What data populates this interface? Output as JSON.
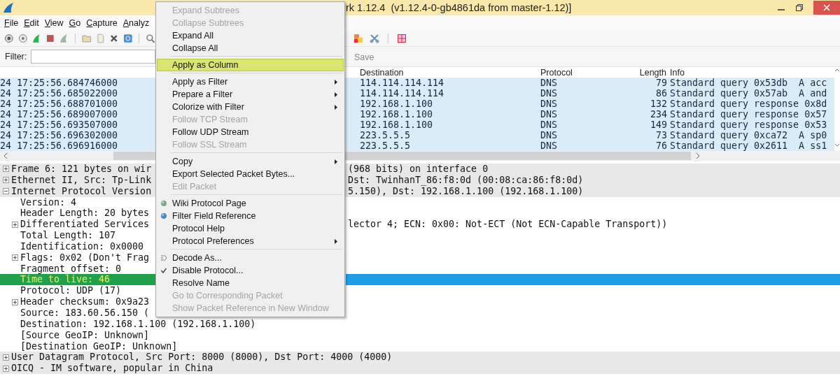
{
  "window": {
    "title": "rk 1.12.4  (v1.12.4-0-gb4861da from master-1.12)]"
  },
  "menu_bar": [
    "File",
    "Edit",
    "View",
    "Go",
    "Capture",
    "Analyz"
  ],
  "filter_bar": {
    "label": "Filter:",
    "save": "Save"
  },
  "packet_list": {
    "columns": [
      "Destination",
      "Protocol",
      "Length",
      "Info"
    ],
    "rows": [
      {
        "time": "24 17:25:56.684746000",
        "destination": "114.114.114.114",
        "protocol": "DNS",
        "length": "79",
        "info": "Standard query 0x53db  A acc"
      },
      {
        "time": "24 17:25:56.685022000",
        "destination": "114.114.114.114",
        "protocol": "DNS",
        "length": "86",
        "info": "Standard query 0x57ab  A and"
      },
      {
        "time": "24 17:25:56.688701000",
        "destination": "192.168.1.100",
        "protocol": "DNS",
        "length": "132",
        "info": "Standard query response 0x8d"
      },
      {
        "time": "24 17:25:56.689007000",
        "destination": "192.168.1.100",
        "protocol": "DNS",
        "length": "234",
        "info": "Standard query response 0x57"
      },
      {
        "time": "24 17:25:56.693507000",
        "destination": "192.168.1.100",
        "protocol": "DNS",
        "length": "149",
        "info": "Standard query response 0x53"
      },
      {
        "time": "24 17:25:56.696302000",
        "destination": "223.5.5.5",
        "protocol": "DNS",
        "length": "73",
        "info": "Standard query 0xca72  A sp0"
      },
      {
        "time": "24 17:25:56.696916000",
        "destination": "223.5.5.5",
        "protocol": "DNS",
        "length": "76",
        "info": "Standard query 0x2611  A ss1"
      }
    ]
  },
  "details": [
    {
      "text": "Frame 6: 121 bytes on wir",
      "text_right": "(968 bits) on interface 0",
      "expanded": false,
      "selected": false
    },
    {
      "text": "Ethernet II, Src: Tp-Link",
      "text_right": "Dst: TwinhanT_86:f8:0d (00:08:ca:86:f8:0d)",
      "expanded": false,
      "selected": false
    },
    {
      "text": "Internet Protocol Version",
      "text_right": "5.150), Dst: 192.168.1.100 (192.168.1.100)",
      "expanded": true,
      "selected": false,
      "children": [
        {
          "text": "Version: 4",
          "selected": false
        },
        {
          "text": "Header Length: 20 bytes",
          "selected": false
        },
        {
          "text": "Differentiated Services",
          "text_right": "lector 4; ECN: 0x00: Not-ECT (Not ECN-Capable Transport))",
          "expanded": false,
          "selected": false
        },
        {
          "text": "Total Length: 107",
          "selected": false
        },
        {
          "text": "Identification: 0x0000",
          "selected": false
        },
        {
          "text": "Flags: 0x02 (Don't Frag",
          "expanded": false,
          "selected": false
        },
        {
          "text": "Fragment offset: 0",
          "selected": false
        },
        {
          "text": "Time to live: 46",
          "selected": true
        },
        {
          "text": "Protocol: UDP (17)",
          "selected": false
        },
        {
          "text": "Header checksum: 0x9a23",
          "expanded": false,
          "selected": false
        },
        {
          "text": "Source: 183.60.56.150 (",
          "selected": false
        },
        {
          "text": "Destination: 192.168.1.100 (192.168.1.100)",
          "selected": false
        },
        {
          "text": "[Source GeoIP: Unknown]",
          "selected": false
        },
        {
          "text": "[Destination GeoIP: Unknown]",
          "selected": false
        }
      ]
    },
    {
      "text": "User Datagram Protocol, Src Port: 8000 (8000), Dst Port: 4000 (4000)",
      "expanded": false,
      "selected": false
    },
    {
      "text": "OICQ - IM software, popular in China",
      "expanded": false,
      "selected": false
    }
  ],
  "context_menu": [
    {
      "kind": "item",
      "label": "Expand Subtrees",
      "disabled": true,
      "selected": false,
      "submenu": false
    },
    {
      "kind": "item",
      "label": "Collapse Subtrees",
      "disabled": true,
      "selected": false,
      "submenu": false
    },
    {
      "kind": "item",
      "label": "Expand All",
      "disabled": false,
      "selected": false,
      "submenu": false
    },
    {
      "kind": "item",
      "label": "Collapse All",
      "disabled": false,
      "selected": false,
      "submenu": false
    },
    {
      "kind": "separator"
    },
    {
      "kind": "item",
      "label": "Apply as Column",
      "disabled": false,
      "selected": true,
      "submenu": false
    },
    {
      "kind": "separator"
    },
    {
      "kind": "item",
      "label": "Apply as Filter",
      "disabled": false,
      "selected": false,
      "submenu": true
    },
    {
      "kind": "item",
      "label": "Prepare a Filter",
      "disabled": false,
      "selected": false,
      "submenu": true
    },
    {
      "kind": "item",
      "label": "Colorize with Filter",
      "disabled": false,
      "selected": false,
      "submenu": true
    },
    {
      "kind": "item",
      "label": "Follow TCP Stream",
      "disabled": true,
      "selected": false,
      "submenu": false
    },
    {
      "kind": "item",
      "label": "Follow UDP Stream",
      "disabled": false,
      "selected": false,
      "submenu": false
    },
    {
      "kind": "item",
      "label": "Follow SSL Stream",
      "disabled": true,
      "selected": false,
      "submenu": false
    },
    {
      "kind": "separator"
    },
    {
      "kind": "item",
      "label": "Copy",
      "disabled": false,
      "selected": false,
      "submenu": true
    },
    {
      "kind": "item",
      "label": "Export Selected Packet Bytes...",
      "disabled": false,
      "selected": false,
      "submenu": false
    },
    {
      "kind": "item",
      "label": "Edit Packet",
      "disabled": true,
      "selected": false,
      "submenu": false
    },
    {
      "kind": "separator"
    },
    {
      "kind": "item",
      "label": "Wiki Protocol Page",
      "disabled": false,
      "selected": false,
      "submenu": false
    },
    {
      "kind": "item",
      "label": "Filter Field Reference",
      "disabled": false,
      "selected": false,
      "submenu": false
    },
    {
      "kind": "item",
      "label": "Protocol Help",
      "disabled": false,
      "selected": false,
      "submenu": false
    },
    {
      "kind": "item",
      "label": "Protocol Preferences",
      "disabled": false,
      "selected": false,
      "submenu": true
    },
    {
      "kind": "separator"
    },
    {
      "kind": "item",
      "label": "Decode As...",
      "disabled": false,
      "selected": false,
      "submenu": false
    },
    {
      "kind": "item",
      "label": "Disable Protocol...",
      "disabled": false,
      "selected": false,
      "submenu": false
    },
    {
      "kind": "item",
      "label": "Resolve Name",
      "disabled": false,
      "selected": false,
      "submenu": false
    },
    {
      "kind": "item",
      "label": "Go to Corresponding Packet",
      "disabled": true,
      "selected": false,
      "submenu": false
    },
    {
      "kind": "item",
      "label": "Show Packet Reference in New Window",
      "disabled": true,
      "selected": false,
      "submenu": false
    }
  ]
}
